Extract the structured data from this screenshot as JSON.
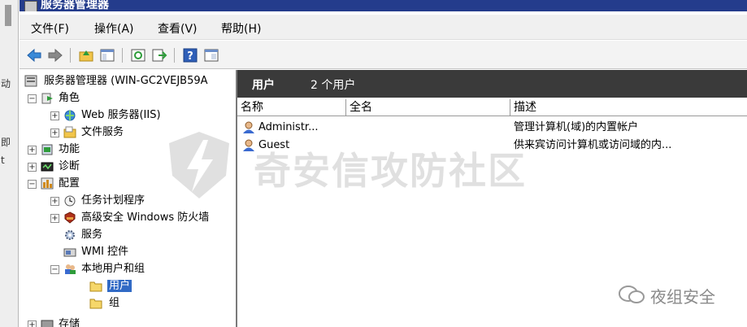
{
  "window": {
    "title": "服务器管理器"
  },
  "left_strip": [
    "动",
    "即",
    "t"
  ],
  "menu": [
    "文件(F)",
    "操作(A)",
    "查看(V)",
    "帮助(H)"
  ],
  "toolbar": [
    "back-icon",
    "forward-icon",
    "up-folder-icon",
    "show-hide-tree-icon",
    "refresh-icon",
    "export-list-icon",
    "help-icon",
    "properties-icon"
  ],
  "tree": {
    "root": "服务器管理器 (WIN-GC2VEJB59A",
    "nodes": {
      "roles": "角色",
      "web": "Web 服务器(IIS)",
      "file": "文件服务",
      "features": "功能",
      "diagnostics": "诊断",
      "config": "配置",
      "task": "任务计划程序",
      "firewall": "高级安全 Windows 防火墙",
      "services": "服务",
      "wmi": "WMI 控件",
      "local_users": "本地用户和组",
      "users": "用户",
      "groups": "组",
      "storage": "存储"
    }
  },
  "content": {
    "title": "用户",
    "count": "2 个用户",
    "columns": [
      "名称",
      "全名",
      "描述"
    ],
    "rows": [
      {
        "name": "Administr...",
        "fullname": "",
        "desc": "管理计算机(域)的内置帐户"
      },
      {
        "name": "Guest",
        "fullname": "",
        "desc": "供来宾访问计算机或访问域的内..."
      }
    ]
  },
  "watermark": "奇安信攻防社区",
  "logo": "夜组安全"
}
